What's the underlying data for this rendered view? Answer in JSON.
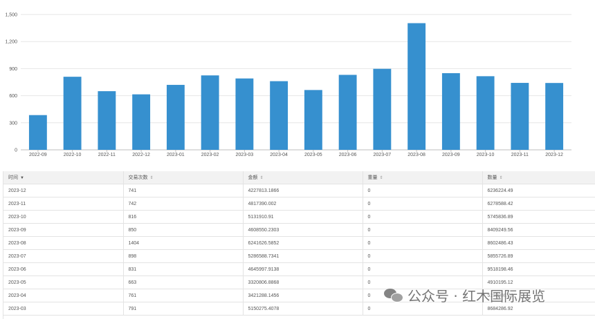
{
  "chart_data": {
    "type": "bar",
    "categories": [
      "2022-09",
      "2022-10",
      "2022-11",
      "2022-12",
      "2023-01",
      "2023-02",
      "2023-03",
      "2023-04",
      "2023-05",
      "2023-06",
      "2023-07",
      "2023-08",
      "2023-09",
      "2023-10",
      "2023-11",
      "2023-12"
    ],
    "values": [
      385,
      810,
      650,
      615,
      720,
      825,
      791,
      761,
      663,
      831,
      898,
      1404,
      850,
      816,
      742,
      741
    ],
    "ylim": [
      0,
      1500
    ],
    "yticks": [
      0,
      300,
      600,
      900,
      1200,
      1500
    ],
    "ytick_labels": [
      "0",
      "300",
      "600",
      "900",
      "1,200",
      "1,500"
    ],
    "bar_color": "#3690cf",
    "grid": "horizontal"
  },
  "table": {
    "columns": [
      {
        "label": "时间",
        "sort": "desc"
      },
      {
        "label": "交易次数",
        "sort": "both"
      },
      {
        "label": "金额",
        "sort": "both"
      },
      {
        "label": "重量",
        "sort": "both"
      },
      {
        "label": "数量",
        "sort": "both"
      }
    ],
    "rows": [
      [
        "2023-12",
        "741",
        "4227813.1866",
        "0",
        "6236224.49"
      ],
      [
        "2023-11",
        "742",
        "4817390.002",
        "0",
        "6278588.42"
      ],
      [
        "2023-10",
        "816",
        "5131910.91",
        "0",
        "5745836.89"
      ],
      [
        "2023-09",
        "850",
        "4608550.2303",
        "0",
        "8409249.56"
      ],
      [
        "2023-08",
        "1404",
        "6241626.5852",
        "0",
        "8602486.43"
      ],
      [
        "2023-07",
        "898",
        "5286588.7341",
        "0",
        "5855726.89"
      ],
      [
        "2023-06",
        "831",
        "4645997.9138",
        "0",
        "9518198.46"
      ],
      [
        "2023-05",
        "663",
        "3320806.8868",
        "0",
        "4910195.12"
      ],
      [
        "2023-04",
        "761",
        "3421288.1456",
        "0",
        "5192986.24"
      ],
      [
        "2023-03",
        "791",
        "5150275.4078",
        "0",
        "8684286.92"
      ]
    ]
  },
  "watermark": {
    "text": "公众号 · 红木国际展览",
    "icon": "wechat-icon"
  }
}
